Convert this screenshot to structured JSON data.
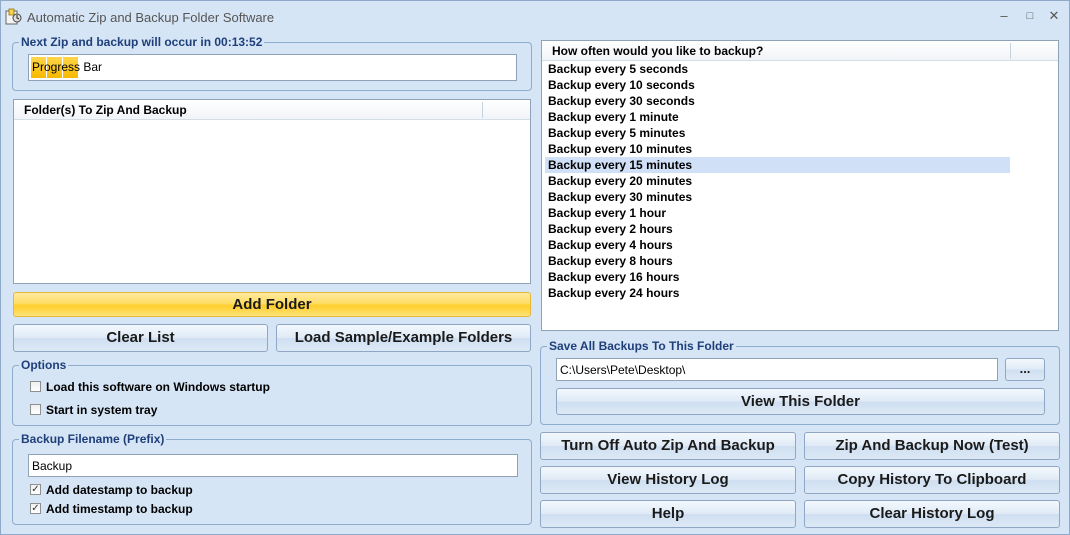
{
  "window": {
    "title": "Automatic Zip and Backup Folder Software",
    "minimize": "–",
    "maximize": "□",
    "close": "✕"
  },
  "schedule": {
    "title": "Next Zip and backup will occur in 00:13:52",
    "progress_text": "Progress Bar"
  },
  "folders": {
    "header": "Folder(s) To Zip And Backup",
    "items": []
  },
  "buttons": {
    "add_folder": "Add Folder",
    "clear_list": "Clear List",
    "load_sample": "Load Sample/Example Folders",
    "view_folder": "View This Folder",
    "browse": "...",
    "turn_off": "Turn Off Auto Zip And Backup",
    "zip_now": "Zip And Backup Now (Test)",
    "view_history": "View History Log",
    "copy_history": "Copy History To Clipboard",
    "help": "Help",
    "clear_history": "Clear History Log"
  },
  "options": {
    "title": "Options",
    "load_on_startup": {
      "label": "Load this software on Windows startup",
      "checked": false
    },
    "start_in_tray": {
      "label": "Start in system tray",
      "checked": false
    }
  },
  "filename": {
    "title": "Backup Filename (Prefix)",
    "value": "Backup",
    "add_datestamp": {
      "label": "Add datestamp to backup",
      "checked": true
    },
    "add_timestamp": {
      "label": "Add timestamp to backup",
      "checked": true
    }
  },
  "frequency": {
    "header": "How often would you like to backup?",
    "items": [
      "Backup every 5 seconds",
      "Backup every 10 seconds",
      "Backup every 30 seconds",
      "Backup every 1 minute",
      "Backup every 5 minutes",
      "Backup every 10 minutes",
      "Backup every 15 minutes",
      "Backup every 20 minutes",
      "Backup every 30 minutes",
      "Backup every 1 hour",
      "Backup every 2 hours",
      "Backup every 4 hours",
      "Backup every 8 hours",
      "Backup every 16 hours",
      "Backup every 24 hours"
    ],
    "selected_index": 6
  },
  "save_folder": {
    "title": "Save All Backups To This Folder",
    "path": "C:\\Users\\Pete\\Desktop\\"
  },
  "colors": {
    "accent": "#1e3f7a",
    "selection": "#cfe0f7",
    "progress": "#f6b900"
  }
}
